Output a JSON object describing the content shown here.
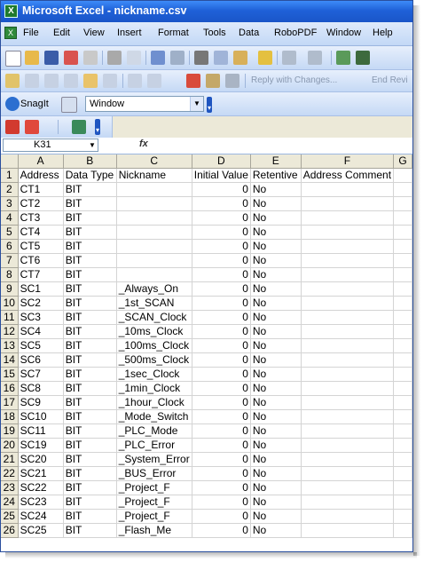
{
  "window": {
    "title": "Microsoft Excel - nickname.csv",
    "app_icon": "excel-icon"
  },
  "menubar": {
    "items": [
      "File",
      "Edit",
      "View",
      "Insert",
      "Format",
      "Tools",
      "Data",
      "RoboPDF",
      "Window",
      "Help"
    ]
  },
  "reviewing_toolbar": {
    "reply_label": "Reply with Changes...",
    "end_review_label": "End Revi"
  },
  "snagit_toolbar": {
    "snagit_label": "SnagIt",
    "capture_mode": "Window"
  },
  "formula_bar": {
    "name_box": "K31",
    "fx_label": "fx",
    "content": ""
  },
  "sheet": {
    "column_headers": [
      "A",
      "B",
      "C",
      "D",
      "E",
      "F",
      "G"
    ],
    "rows": [
      [
        "1",
        "Address",
        "Data Type",
        "Nickname",
        "Initial Value",
        "Retentive",
        "Address Comment",
        ""
      ],
      [
        "2",
        "CT1",
        "BIT",
        "",
        "0",
        "No",
        "",
        ""
      ],
      [
        "3",
        "CT2",
        "BIT",
        "",
        "0",
        "No",
        "",
        ""
      ],
      [
        "4",
        "CT3",
        "BIT",
        "",
        "0",
        "No",
        "",
        ""
      ],
      [
        "5",
        "CT4",
        "BIT",
        "",
        "0",
        "No",
        "",
        ""
      ],
      [
        "6",
        "CT5",
        "BIT",
        "",
        "0",
        "No",
        "",
        ""
      ],
      [
        "7",
        "CT6",
        "BIT",
        "",
        "0",
        "No",
        "",
        ""
      ],
      [
        "8",
        "CT7",
        "BIT",
        "",
        "0",
        "No",
        "",
        ""
      ],
      [
        "9",
        "SC1",
        "BIT",
        "_Always_On",
        "0",
        "No",
        "",
        ""
      ],
      [
        "10",
        "SC2",
        "BIT",
        "_1st_SCAN",
        "0",
        "No",
        "",
        ""
      ],
      [
        "11",
        "SC3",
        "BIT",
        "_SCAN_Clock",
        "0",
        "No",
        "",
        ""
      ],
      [
        "12",
        "SC4",
        "BIT",
        "_10ms_Clock",
        "0",
        "No",
        "",
        ""
      ],
      [
        "13",
        "SC5",
        "BIT",
        "_100ms_Clock",
        "0",
        "No",
        "",
        ""
      ],
      [
        "14",
        "SC6",
        "BIT",
        "_500ms_Clock",
        "0",
        "No",
        "",
        ""
      ],
      [
        "15",
        "SC7",
        "BIT",
        "_1sec_Clock",
        "0",
        "No",
        "",
        ""
      ],
      [
        "16",
        "SC8",
        "BIT",
        "_1min_Clock",
        "0",
        "No",
        "",
        ""
      ],
      [
        "17",
        "SC9",
        "BIT",
        "_1hour_Clock",
        "0",
        "No",
        "",
        ""
      ],
      [
        "18",
        "SC10",
        "BIT",
        "_Mode_Switch",
        "0",
        "No",
        "",
        ""
      ],
      [
        "19",
        "SC11",
        "BIT",
        "_PLC_Mode",
        "0",
        "No",
        "",
        ""
      ],
      [
        "20",
        "SC19",
        "BIT",
        "_PLC_Error",
        "0",
        "No",
        "",
        ""
      ],
      [
        "21",
        "SC20",
        "BIT",
        "_System_Error",
        "0",
        "No",
        "",
        ""
      ],
      [
        "22",
        "SC21",
        "BIT",
        "_BUS_Error",
        "0",
        "No",
        "",
        ""
      ],
      [
        "23",
        "SC22",
        "BIT",
        "_Project_F",
        "0",
        "No",
        "",
        ""
      ],
      [
        "24",
        "SC23",
        "BIT",
        "_Project_F",
        "0",
        "No",
        "",
        ""
      ],
      [
        "25",
        "SC24",
        "BIT",
        "_Project_F",
        "0",
        "No",
        "",
        ""
      ],
      [
        "26",
        "SC25",
        "BIT",
        "_Flash_Me",
        "0",
        "No",
        "",
        ""
      ]
    ]
  }
}
